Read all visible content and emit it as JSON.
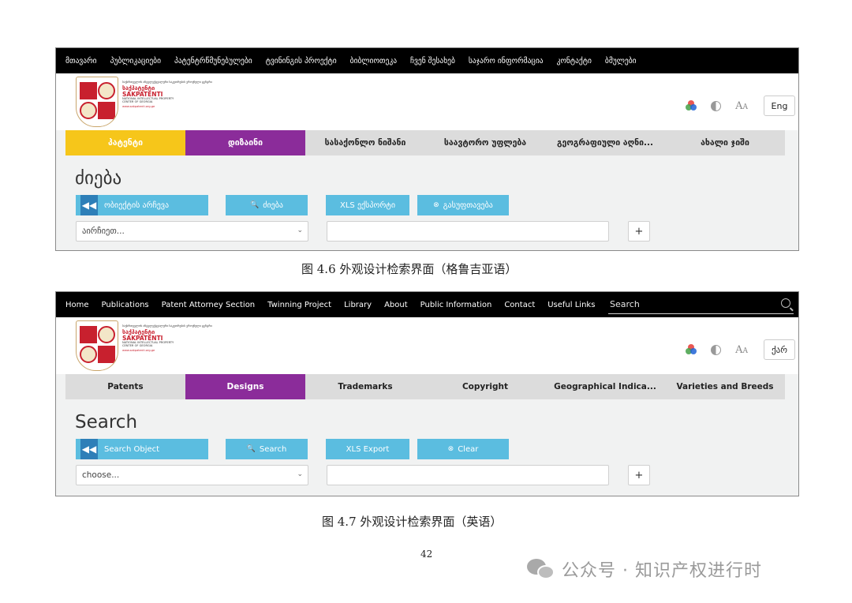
{
  "figure1": {
    "nav": [
      "მთავარი",
      "პუბლიკაციები",
      "პატენტრწმუნებულები",
      "ტვინინგის პროექტი",
      "ბიბლიოთეკა",
      "ჩვენ შესახებ",
      "საჯარო ინფორმაცია",
      "კონტაქტი",
      "ბმულები"
    ],
    "faint_search": "ძიება",
    "logo": {
      "small_text": "საქართველოს ინტელექტუალური საკუთრების ეროვნული ცენტრი",
      "geo_name": "საქპატენტი",
      "name": "SAKPATENTI",
      "subtitle": "NATIONAL INTELLECTUAL PROPERTY CENTER OF GEORGIA",
      "url": "www.sakpatenti.org.ge"
    },
    "font_icon": "A",
    "font_icon_small": "A",
    "lang_button": "Eng",
    "categories": [
      "პატენტი",
      "დიზაინი",
      "სასაქონლო ნიშანი",
      "საავტორო უფლება",
      "გეოგრაფიული აღნი...",
      "ახალი ჯიში"
    ],
    "page_title": "ძიება",
    "buttons": {
      "search_object": "ობიექტის არჩევა",
      "search": "ძიება",
      "xls_export": "XLS ექსპორტი",
      "clear": "გასუფთავება"
    },
    "select_value": "აირჩიეთ...",
    "plus": "+"
  },
  "caption1": "图 4.6  外观设计检索界面（格鲁吉亚语）",
  "figure2": {
    "nav": [
      "Home",
      "Publications",
      "Patent Attorney Section",
      "Twinning Project",
      "Library",
      "About",
      "Public Information",
      "Contact",
      "Useful Links"
    ],
    "search_placeholder": "Search",
    "logo": {
      "small_text": "საქართველოს ინტელექტუალური საკუთრების ეროვნული ცენტრი",
      "geo_name": "საქპატენტი",
      "name": "SAKPATENTI",
      "subtitle": "NATIONAL INTELLECTUAL PROPERTY CENTER OF GEORGIA",
      "url": "www.sakpatenti.org.ge"
    },
    "font_icon": "A",
    "font_icon_small": "A",
    "lang_button": "ქარ",
    "categories": [
      "Patents",
      "Designs",
      "Trademarks",
      "Copyright",
      "Geographical Indica...",
      "Varieties and Breeds"
    ],
    "page_title": "Search",
    "buttons": {
      "search_object": "Search Object",
      "search": "Search",
      "xls_export": "XLS Export",
      "clear": "Clear"
    },
    "select_value": "choose...",
    "plus": "+"
  },
  "caption2": "图 4.7  外观设计检索界面（英语）",
  "page_number": "42",
  "watermark": "公众号 · 知识产权进行时",
  "colors": {
    "nav_bg": "#000000",
    "active_tab": "#8b2c9a",
    "patent_tab_geo": "#f6c61a",
    "button": "#5bbde0",
    "logo_red": "#c8202e"
  },
  "icons": [
    "search-icon",
    "color-palette-icon",
    "contrast-icon",
    "font-size-icon",
    "back-arrow-icon",
    "magnifier-icon",
    "clear-icon",
    "chevron-down-icon",
    "wechat-icon"
  ]
}
